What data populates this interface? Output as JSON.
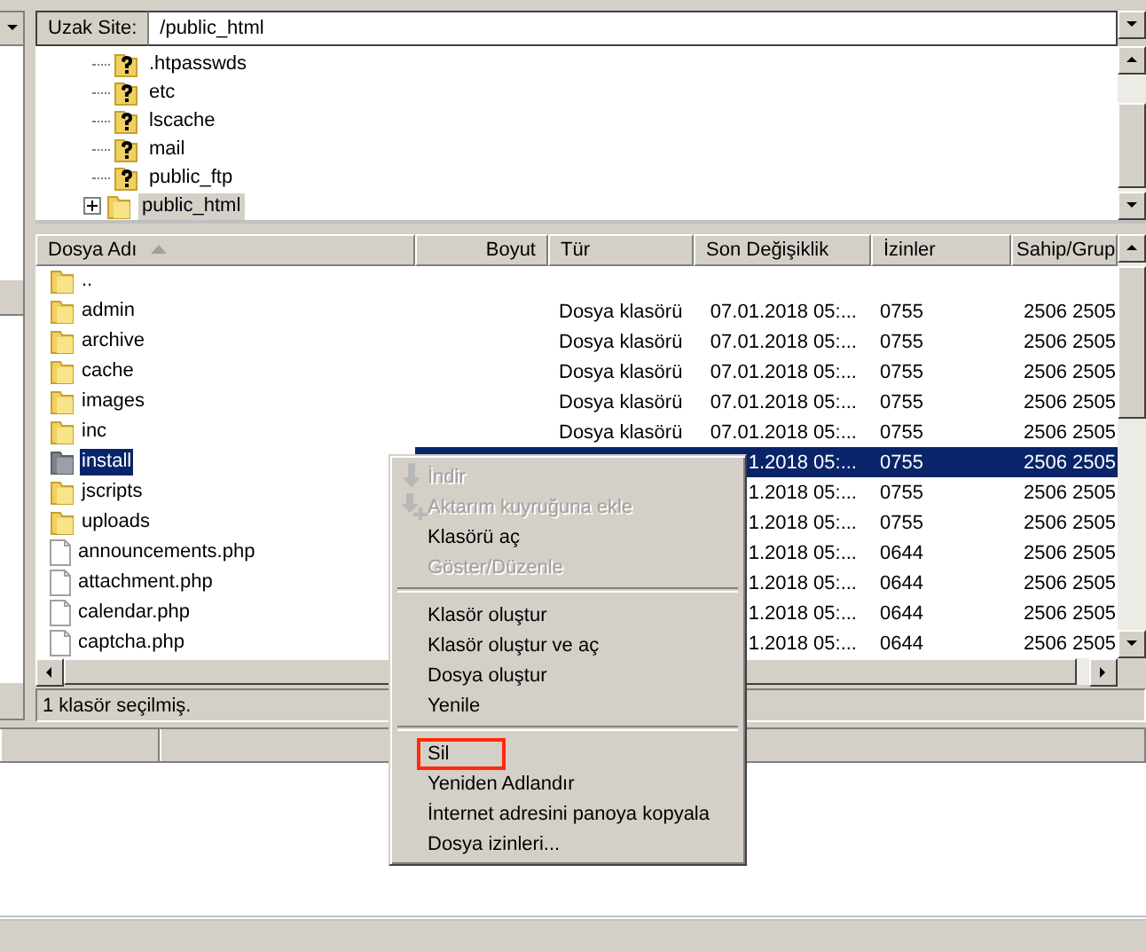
{
  "remote_site": {
    "label": "Uzak Site:",
    "value": "/public_html"
  },
  "tree": [
    {
      "name": ".htpasswds",
      "kind": "unknown",
      "selected": false,
      "expandable": false
    },
    {
      "name": "etc",
      "kind": "unknown",
      "selected": false,
      "expandable": false
    },
    {
      "name": "lscache",
      "kind": "unknown",
      "selected": false,
      "expandable": false
    },
    {
      "name": "mail",
      "kind": "unknown",
      "selected": false,
      "expandable": false
    },
    {
      "name": "public_ftp",
      "kind": "unknown",
      "selected": false,
      "expandable": false
    },
    {
      "name": "public_html",
      "kind": "folder",
      "selected": true,
      "expandable": true
    }
  ],
  "columns": [
    {
      "label": "Dosya Adı",
      "sorted": true
    },
    {
      "label": "Boyut",
      "sorted": false
    },
    {
      "label": "Tür",
      "sorted": false
    },
    {
      "label": "Son Değişiklik",
      "sorted": false
    },
    {
      "label": "İzinler",
      "sorted": false
    },
    {
      "label": "Sahip/Grup",
      "sorted": false
    }
  ],
  "rows": [
    {
      "kind": "parent",
      "name": "..",
      "selected": false
    },
    {
      "kind": "folder",
      "name": "admin",
      "type": "Dosya klasörü",
      "modified": "07.01.2018 05:...",
      "permissions": "0755",
      "owner": "2506 2505",
      "selected": false
    },
    {
      "kind": "folder",
      "name": "archive",
      "type": "Dosya klasörü",
      "modified": "07.01.2018 05:...",
      "permissions": "0755",
      "owner": "2506 2505",
      "selected": false
    },
    {
      "kind": "folder",
      "name": "cache",
      "type": "Dosya klasörü",
      "modified": "07.01.2018 05:...",
      "permissions": "0755",
      "owner": "2506 2505",
      "selected": false
    },
    {
      "kind": "folder",
      "name": "images",
      "type": "Dosya klasörü",
      "modified": "07.01.2018 05:...",
      "permissions": "0755",
      "owner": "2506 2505",
      "selected": false
    },
    {
      "kind": "folder",
      "name": "inc",
      "type": "Dosya klasörü",
      "modified": "07.01.2018 05:...",
      "permissions": "0755",
      "owner": "2506 2505",
      "selected": false
    },
    {
      "kind": "folder",
      "name": "install",
      "modified": "1.2018 05:...",
      "permissions": "0755",
      "owner": "2506 2505",
      "selected": true
    },
    {
      "kind": "folder",
      "name": "jscripts",
      "modified": "1.2018 05:...",
      "permissions": "0755",
      "owner": "2506 2505",
      "selected": false
    },
    {
      "kind": "folder",
      "name": "uploads",
      "modified": "1.2018 05:...",
      "permissions": "0755",
      "owner": "2506 2505",
      "selected": false
    },
    {
      "kind": "file",
      "name": "announcements.php",
      "modified": "1.2018 05:...",
      "permissions": "0644",
      "owner": "2506 2505",
      "selected": false
    },
    {
      "kind": "file",
      "name": "attachment.php",
      "modified": "1.2018 05:...",
      "permissions": "0644",
      "owner": "2506 2505",
      "selected": false
    },
    {
      "kind": "file",
      "name": "calendar.php",
      "modified": "1.2018 05:...",
      "permissions": "0644",
      "owner": "2506 2505",
      "selected": false
    },
    {
      "kind": "file",
      "name": "captcha.php",
      "modified": "1.2018 05:...",
      "permissions": "0644",
      "owner": "2506 2505",
      "selected": false
    }
  ],
  "status": "1 klasör seçilmiş.",
  "context_menu": [
    {
      "kind": "download",
      "label": "İndir",
      "disabled": true,
      "highlighted": false
    },
    {
      "kind": "enqueue",
      "label": "Aktarım kuyruğuna ekle",
      "disabled": true,
      "highlighted": false
    },
    {
      "kind": "item",
      "label": "Klasörü aç",
      "disabled": false,
      "highlighted": false
    },
    {
      "kind": "item",
      "label": "Göster/Düzenle",
      "disabled": true,
      "highlighted": false
    },
    {
      "kind": "separator"
    },
    {
      "kind": "item",
      "label": "Klasör oluştur",
      "disabled": false,
      "highlighted": false
    },
    {
      "kind": "item",
      "label": "Klasör oluştur ve aç",
      "disabled": false,
      "highlighted": false
    },
    {
      "kind": "item",
      "label": "Dosya oluştur",
      "disabled": false,
      "highlighted": false
    },
    {
      "kind": "item",
      "label": "Yenile",
      "disabled": false,
      "highlighted": false
    },
    {
      "kind": "separator"
    },
    {
      "kind": "item",
      "label": "Sil",
      "disabled": false,
      "highlighted": true
    },
    {
      "kind": "item",
      "label": "Yeniden Adlandır",
      "disabled": false,
      "highlighted": false
    },
    {
      "kind": "item",
      "label": "İnternet adresini panoya kopyala",
      "disabled": false,
      "highlighted": false
    },
    {
      "kind": "item",
      "label": "Dosya izinleri...",
      "disabled": false,
      "highlighted": false
    }
  ]
}
